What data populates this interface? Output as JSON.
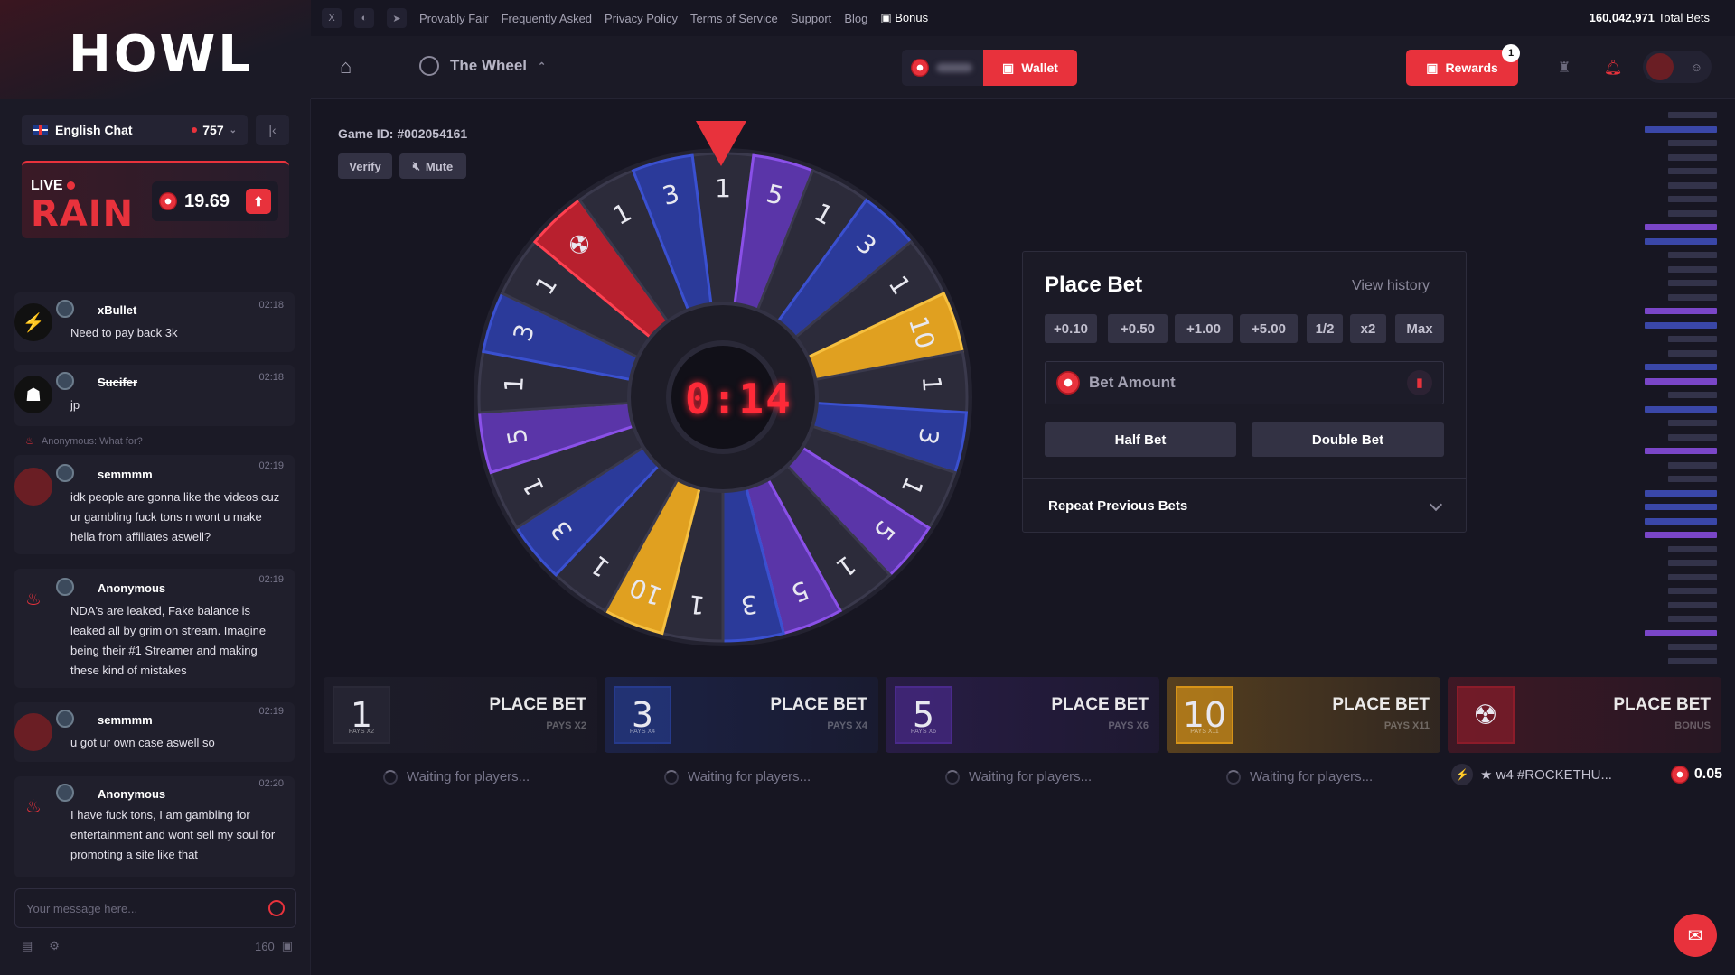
{
  "sidebar": {
    "logo": "HOWL",
    "chat_room": "English Chat",
    "online_count": "757",
    "rain": {
      "live": "LIVE",
      "title": "RAIN",
      "amount": "19.69"
    },
    "messages": [
      {
        "user": "xBullet",
        "time": "02:18",
        "text": "Need to pay back 3k"
      },
      {
        "user": "Sucifer",
        "time": "02:18",
        "text": "jp"
      },
      {
        "user": "semmmm",
        "time": "02:19",
        "text": "idk people are gonna like the videos cuz ur gambling fuck tons n wont u make hella from affiliates aswell?",
        "reply_to": "Anonymous: What for?"
      },
      {
        "user": "Anonymous",
        "time": "02:19",
        "text": "NDA's are leaked, Fake balance is leaked all by grim on stream. Imagine being their #1 Streamer and making these kind of mistakes"
      },
      {
        "user": "semmmm",
        "time": "02:19",
        "text": "u got ur own case aswell so"
      },
      {
        "user": "Anonymous",
        "time": "02:20",
        "text": "I have fuck tons, I am gambling for entertainment and wont sell my soul for promoting a site like that"
      }
    ],
    "input_placeholder": "Your message here...",
    "footer_count": "160"
  },
  "topnav": {
    "links": [
      "Provably Fair",
      "Frequently Asked",
      "Privacy Policy",
      "Terms of Service",
      "Support",
      "Blog"
    ],
    "bonus": "Bonus",
    "total_bets_value": "160,042,971",
    "total_bets_label": "Total Bets"
  },
  "header": {
    "game": "The Wheel",
    "wallet": "Wallet",
    "rewards": "Rewards",
    "rewards_badge": "1"
  },
  "game": {
    "game_id": "Game ID: #002054161",
    "verify": "Verify",
    "mute": "Mute",
    "timer": "0:14",
    "wheel_segments": [
      "1",
      "5",
      "1",
      "3",
      "1",
      "10",
      "1",
      "3",
      "1",
      "5",
      "1",
      "5",
      "3",
      "1",
      "10",
      "1",
      "3",
      "1",
      "5",
      "1",
      "3",
      "1",
      "BONUS",
      "1",
      "3"
    ]
  },
  "bet": {
    "title": "Place Bet",
    "history": "View history",
    "quick": [
      "+0.10",
      "+0.50",
      "+1.00",
      "+5.00",
      "1/2",
      "x2",
      "Max"
    ],
    "amount_placeholder": "Bet Amount",
    "half": "Half Bet",
    "double": "Double Bet",
    "repeat": "Repeat Previous Bets"
  },
  "tiles": [
    {
      "num": "1",
      "pays": "PAYS X2",
      "label": "PLACE BET",
      "color": "#2a2937"
    },
    {
      "num": "3",
      "pays": "PAYS X4",
      "label": "PLACE BET",
      "color": "#263a8c"
    },
    {
      "num": "5",
      "pays": "PAYS X6",
      "label": "PLACE BET",
      "color": "#4a2a8c"
    },
    {
      "num": "10",
      "pays": "PAYS X11",
      "label": "PLACE BET",
      "color": "#d69318"
    },
    {
      "num": "",
      "pays": "BONUS",
      "label": "PLACE BET",
      "color": "#8c1c2a"
    }
  ],
  "waiting": [
    "Waiting for players...",
    "Waiting for players...",
    "Waiting for players...",
    "Waiting for players..."
  ],
  "bonus_bet": {
    "user": "★ w4 #ROCKETHU...",
    "amount": "0.05"
  },
  "history_colors": [
    "#33334a",
    "#3a47a8",
    "#33334a",
    "#33334a",
    "#33334a",
    "#33334a",
    "#33334a",
    "#33334a",
    "#7a46c8",
    "#3a47a8",
    "#33334a",
    "#33334a",
    "#33334a",
    "#33334a",
    "#7a46c8",
    "#3a47a8",
    "#33334a",
    "#33334a",
    "#3a47a8",
    "#7a46c8",
    "#33334a",
    "#3a47a8",
    "#33334a",
    "#33334a",
    "#7a46c8",
    "#33334a",
    "#33334a",
    "#3a47a8",
    "#3a47a8",
    "#3a47a8",
    "#7a46c8",
    "#33334a",
    "#33334a",
    "#33334a",
    "#33334a",
    "#33334a",
    "#33334a",
    "#7a46c8",
    "#33334a",
    "#33334a"
  ]
}
